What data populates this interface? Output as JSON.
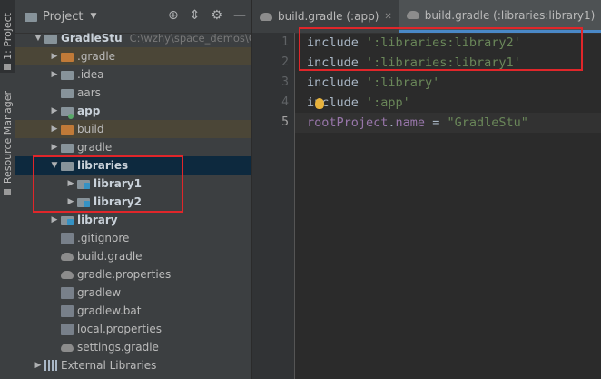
{
  "sidebar_strip": {
    "project_tab": "1: Project",
    "resource_tab": "Resource Manager"
  },
  "panel": {
    "title": "Project",
    "tree": [
      {
        "label": "GradleStu",
        "path": "C:\\wzhy\\space_demos\\Gra",
        "kind": "module",
        "arrow": "down",
        "bold": true
      },
      {
        "label": ".gradle",
        "kind": "folder-orange",
        "arrow": "right"
      },
      {
        "label": ".idea",
        "kind": "folder",
        "arrow": "right"
      },
      {
        "label": "aars",
        "kind": "folder",
        "arrow": ""
      },
      {
        "label": "app",
        "kind": "module-app",
        "arrow": "right",
        "bold": true
      },
      {
        "label": "build",
        "kind": "folder-orange",
        "arrow": "right"
      },
      {
        "label": "gradle",
        "kind": "folder",
        "arrow": "right"
      },
      {
        "label": "libraries",
        "kind": "folder",
        "arrow": "down",
        "bold": true
      },
      {
        "label": "library1",
        "kind": "lib",
        "arrow": "right",
        "bold": true
      },
      {
        "label": "library2",
        "kind": "lib",
        "arrow": "right",
        "bold": true
      },
      {
        "label": "library",
        "kind": "lib",
        "arrow": "right",
        "bold": true
      },
      {
        "label": ".gitignore",
        "kind": "file",
        "arrow": ""
      },
      {
        "label": "build.gradle",
        "kind": "gradle",
        "arrow": ""
      },
      {
        "label": "gradle.properties",
        "kind": "gradle",
        "arrow": ""
      },
      {
        "label": "gradlew",
        "kind": "file",
        "arrow": ""
      },
      {
        "label": "gradlew.bat",
        "kind": "file",
        "arrow": ""
      },
      {
        "label": "local.properties",
        "kind": "file",
        "arrow": ""
      },
      {
        "label": "settings.gradle",
        "kind": "gradle",
        "arrow": ""
      },
      {
        "label": "External Libraries",
        "kind": "extlib",
        "arrow": "right"
      }
    ]
  },
  "editor": {
    "tabs": [
      {
        "label": "build.gradle (:app)",
        "active": false
      },
      {
        "label": "build.gradle (:libraries:library1)",
        "active": true
      }
    ],
    "lines": [
      {
        "n": "1",
        "kw": "include ",
        "str": "':libraries:library2'"
      },
      {
        "n": "2",
        "kw": "include ",
        "str": "':libraries:library1'"
      },
      {
        "n": "3",
        "kw": "include ",
        "str": "':library'"
      },
      {
        "n": "4",
        "kw": "include ",
        "str": "':app'"
      },
      {
        "n": "5",
        "prop": "rootProject",
        "dot": ".",
        "field": "name",
        "eq": " = ",
        "str": "\"GradleStu\""
      }
    ]
  }
}
